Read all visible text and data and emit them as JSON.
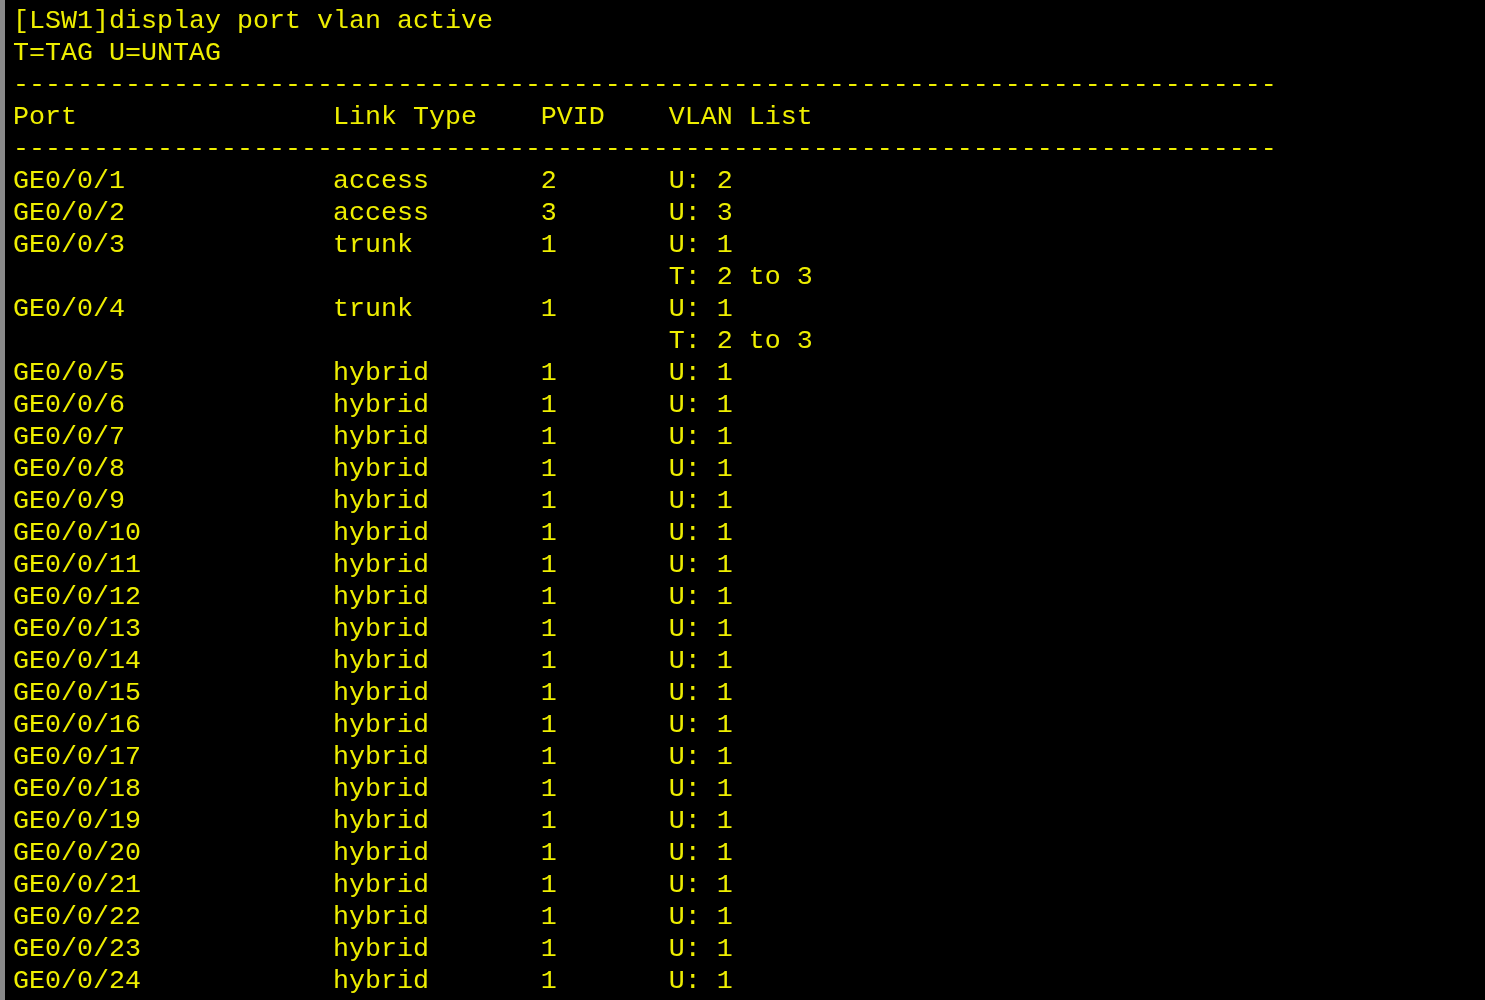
{
  "command": "[LSW1]display port vlan active",
  "legend": "T=TAG U=UNTAG",
  "separator_top": "-------------------------------------------------------------------------------",
  "columns": [
    "Port",
    "Link Type",
    "PVID",
    "VLAN List"
  ],
  "separator_bottom": "-------------------------------------------------------------------------------",
  "rows": [
    {
      "port": "GE0/0/1",
      "link_type": "access",
      "pvid": "2",
      "vlan_list": [
        "U: 2"
      ]
    },
    {
      "port": "GE0/0/2",
      "link_type": "access",
      "pvid": "3",
      "vlan_list": [
        "U: 3"
      ]
    },
    {
      "port": "GE0/0/3",
      "link_type": "trunk",
      "pvid": "1",
      "vlan_list": [
        "U: 1",
        "T: 2 to 3"
      ]
    },
    {
      "port": "GE0/0/4",
      "link_type": "trunk",
      "pvid": "1",
      "vlan_list": [
        "U: 1",
        "T: 2 to 3"
      ]
    },
    {
      "port": "GE0/0/5",
      "link_type": "hybrid",
      "pvid": "1",
      "vlan_list": [
        "U: 1"
      ]
    },
    {
      "port": "GE0/0/6",
      "link_type": "hybrid",
      "pvid": "1",
      "vlan_list": [
        "U: 1"
      ]
    },
    {
      "port": "GE0/0/7",
      "link_type": "hybrid",
      "pvid": "1",
      "vlan_list": [
        "U: 1"
      ]
    },
    {
      "port": "GE0/0/8",
      "link_type": "hybrid",
      "pvid": "1",
      "vlan_list": [
        "U: 1"
      ]
    },
    {
      "port": "GE0/0/9",
      "link_type": "hybrid",
      "pvid": "1",
      "vlan_list": [
        "U: 1"
      ]
    },
    {
      "port": "GE0/0/10",
      "link_type": "hybrid",
      "pvid": "1",
      "vlan_list": [
        "U: 1"
      ]
    },
    {
      "port": "GE0/0/11",
      "link_type": "hybrid",
      "pvid": "1",
      "vlan_list": [
        "U: 1"
      ]
    },
    {
      "port": "GE0/0/12",
      "link_type": "hybrid",
      "pvid": "1",
      "vlan_list": [
        "U: 1"
      ]
    },
    {
      "port": "GE0/0/13",
      "link_type": "hybrid",
      "pvid": "1",
      "vlan_list": [
        "U: 1"
      ]
    },
    {
      "port": "GE0/0/14",
      "link_type": "hybrid",
      "pvid": "1",
      "vlan_list": [
        "U: 1"
      ]
    },
    {
      "port": "GE0/0/15",
      "link_type": "hybrid",
      "pvid": "1",
      "vlan_list": [
        "U: 1"
      ]
    },
    {
      "port": "GE0/0/16",
      "link_type": "hybrid",
      "pvid": "1",
      "vlan_list": [
        "U: 1"
      ]
    },
    {
      "port": "GE0/0/17",
      "link_type": "hybrid",
      "pvid": "1",
      "vlan_list": [
        "U: 1"
      ]
    },
    {
      "port": "GE0/0/18",
      "link_type": "hybrid",
      "pvid": "1",
      "vlan_list": [
        "U: 1"
      ]
    },
    {
      "port": "GE0/0/19",
      "link_type": "hybrid",
      "pvid": "1",
      "vlan_list": [
        "U: 1"
      ]
    },
    {
      "port": "GE0/0/20",
      "link_type": "hybrid",
      "pvid": "1",
      "vlan_list": [
        "U: 1"
      ]
    },
    {
      "port": "GE0/0/21",
      "link_type": "hybrid",
      "pvid": "1",
      "vlan_list": [
        "U: 1"
      ]
    },
    {
      "port": "GE0/0/22",
      "link_type": "hybrid",
      "pvid": "1",
      "vlan_list": [
        "U: 1"
      ]
    },
    {
      "port": "GE0/0/23",
      "link_type": "hybrid",
      "pvid": "1",
      "vlan_list": [
        "U: 1"
      ]
    },
    {
      "port": "GE0/0/24",
      "link_type": "hybrid",
      "pvid": "1",
      "vlan_list": [
        "U: 1"
      ]
    }
  ]
}
